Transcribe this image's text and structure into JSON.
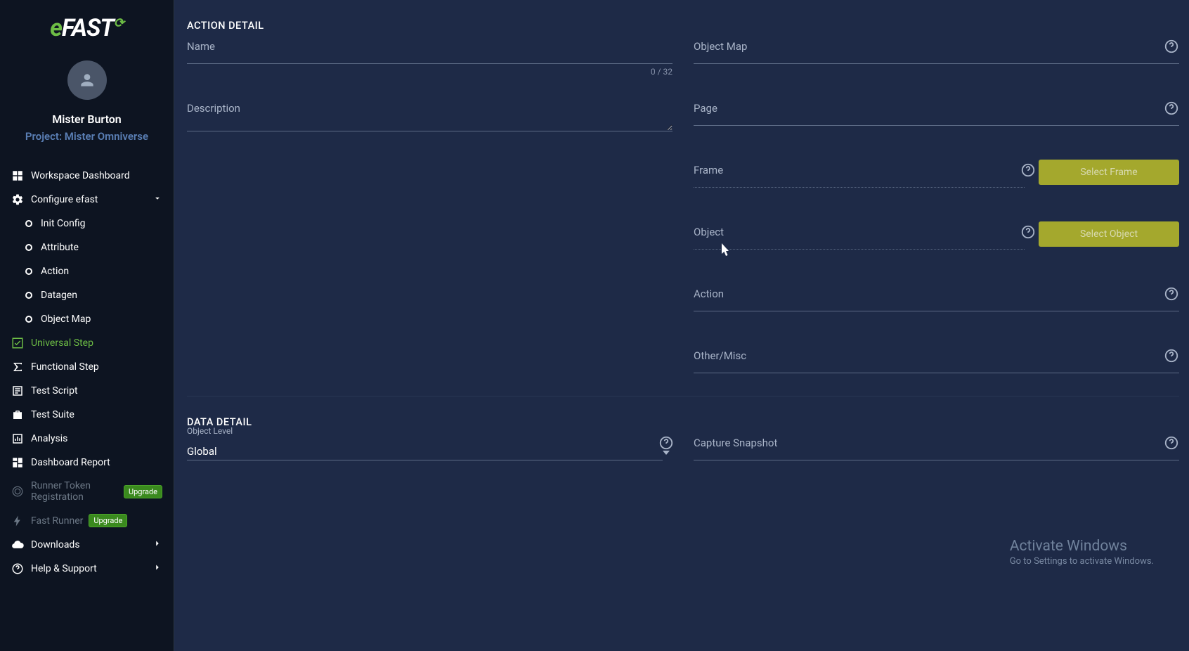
{
  "brand": {
    "text_e": "e",
    "text_fast": "FAST"
  },
  "user": {
    "name": "Mister Burton",
    "project": "Project: Mister Omniverse"
  },
  "nav": {
    "workspace": "Workspace Dashboard",
    "configure": "Configure efast",
    "config_children": {
      "init": "Init Config",
      "attribute": "Attribute",
      "action": "Action",
      "datagen": "Datagen",
      "objectmap": "Object Map"
    },
    "universal_step": "Universal Step",
    "functional_step": "Functional Step",
    "test_script": "Test Script",
    "test_suite": "Test Suite",
    "analysis": "Analysis",
    "dashboard_report": "Dashboard Report",
    "runner_token": "Runner Token Registration",
    "fast_runner": "Fast Runner",
    "downloads": "Downloads",
    "help": "Help & Support",
    "upgrade_badge": "Upgrade"
  },
  "main": {
    "action_detail_title": "ACTION DETAIL",
    "data_detail_title": "DATA DETAIL",
    "labels": {
      "name": "Name",
      "description": "Description",
      "object_map": "Object Map",
      "page": "Page",
      "frame": "Frame",
      "object": "Object",
      "action": "Action",
      "other_misc": "Other/Misc",
      "object_level": "Object Level",
      "capture_snapshot": "Capture Snapshot"
    },
    "values": {
      "name": "",
      "description": "",
      "object_level": "Global"
    },
    "name_counter": "0 / 32",
    "buttons": {
      "select_frame": "Select Frame",
      "select_object": "Select Object"
    }
  },
  "watermark": {
    "title": "Activate Windows",
    "subtitle": "Go to Settings to activate Windows."
  }
}
